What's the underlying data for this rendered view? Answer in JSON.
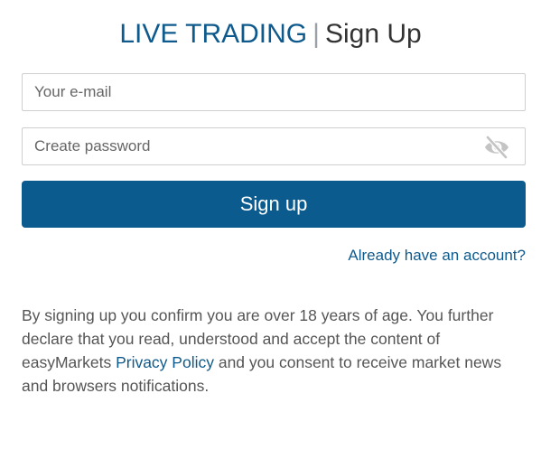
{
  "header": {
    "brand": "LIVE TRADING",
    "separator": "|",
    "page_name": "Sign Up"
  },
  "form": {
    "email_placeholder": "Your e-mail",
    "email_value": "",
    "password_placeholder": "Create password",
    "password_value": "",
    "password_toggle_icon": "eye-slash-icon",
    "submit_label": "Sign up",
    "login_link": "Already have an account?"
  },
  "disclaimer": {
    "text_before": "By signing up you confirm you are over 18 years of age. You further declare that you read, understood and accept the content of easyMarkets ",
    "privacy_link": "Privacy Policy",
    "text_after": " and you consent to receive market news and browsers notifications."
  },
  "colors": {
    "brand_blue": "#0f5a8c",
    "button_blue": "#0b5b8e",
    "text_gray": "#555555",
    "border_gray": "#cfcfcf"
  }
}
